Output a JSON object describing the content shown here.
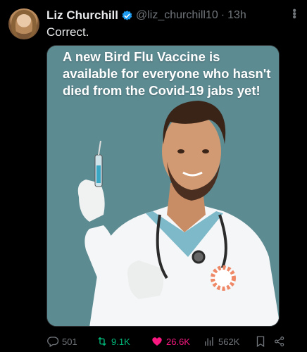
{
  "post": {
    "author_name": "Liz Churchill",
    "handle": "@liz_churchill10",
    "separator": "·",
    "time": "13h",
    "text": "Correct.",
    "verified": true
  },
  "media": {
    "caption": "A new Bird Flu Vaccine is available for everyone who hasn't died from the Covid-19 jabs yet!"
  },
  "actions": {
    "replies": "501",
    "reposts": "9.1K",
    "likes": "26.6K",
    "views": "562K"
  },
  "colors": {
    "background": "#000000",
    "verified": "#1d9bf0",
    "repost_active": "#00ba7c",
    "like_active": "#f91880",
    "muted": "#71767b"
  },
  "icons": [
    "verified-badge-icon",
    "more-icon",
    "reply-icon",
    "repost-icon",
    "like-icon",
    "views-icon",
    "bookmark-icon",
    "share-icon"
  ]
}
